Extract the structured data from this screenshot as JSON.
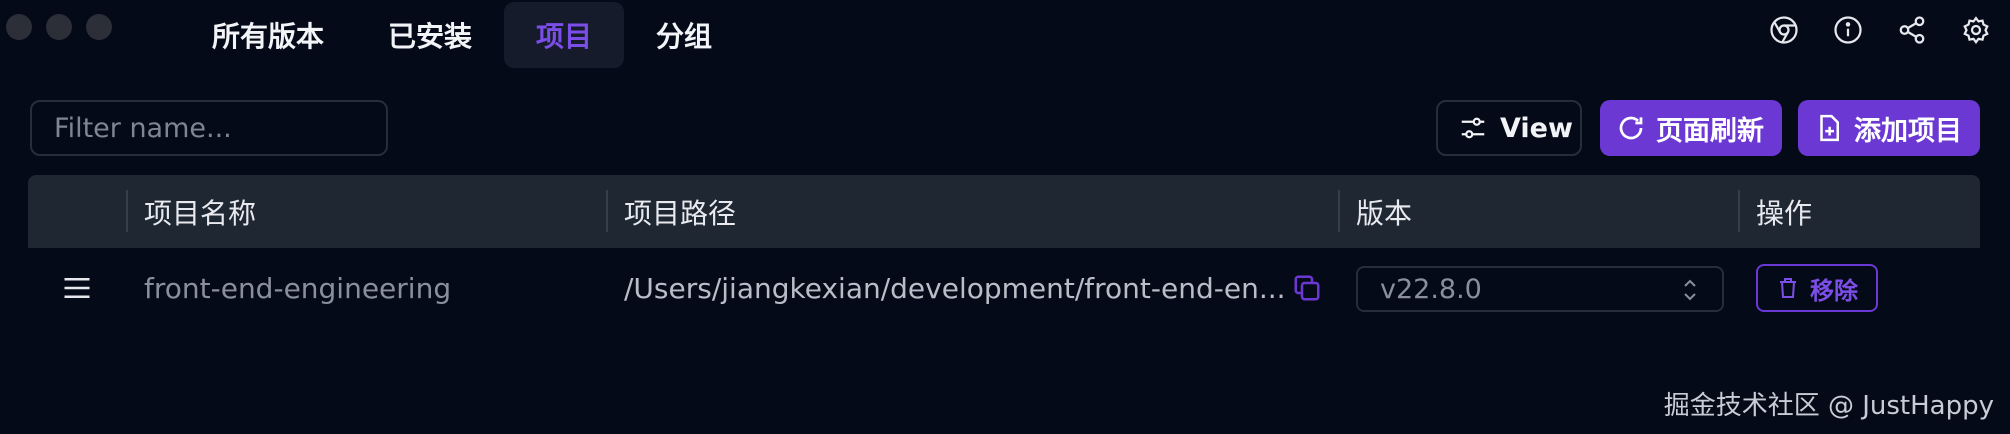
{
  "tabs": [
    {
      "label": "所有版本"
    },
    {
      "label": "已安装"
    },
    {
      "label": "项目"
    },
    {
      "label": "分组"
    }
  ],
  "active_tab": "项目",
  "top_icons": [
    "chrome-icon",
    "info-icon",
    "share-icon",
    "settings-icon"
  ],
  "toolbar": {
    "filter_placeholder": "Filter name...",
    "view_label": "View",
    "refresh_label": "页面刷新",
    "add_label": "添加项目"
  },
  "table": {
    "columns": [
      "项目名称",
      "项目路径",
      "版本",
      "操作"
    ],
    "rows": [
      {
        "name": "front-end-engineering",
        "path": "/Users/jiangkexian/development/front-end-en...",
        "version": "v22.8.0",
        "action": "移除"
      }
    ]
  },
  "watermark": "掘金技术社区 @ JustHappy",
  "colors": {
    "accent": "#6b38d4",
    "background": "#050a18",
    "header_bg": "#1f2733"
  }
}
